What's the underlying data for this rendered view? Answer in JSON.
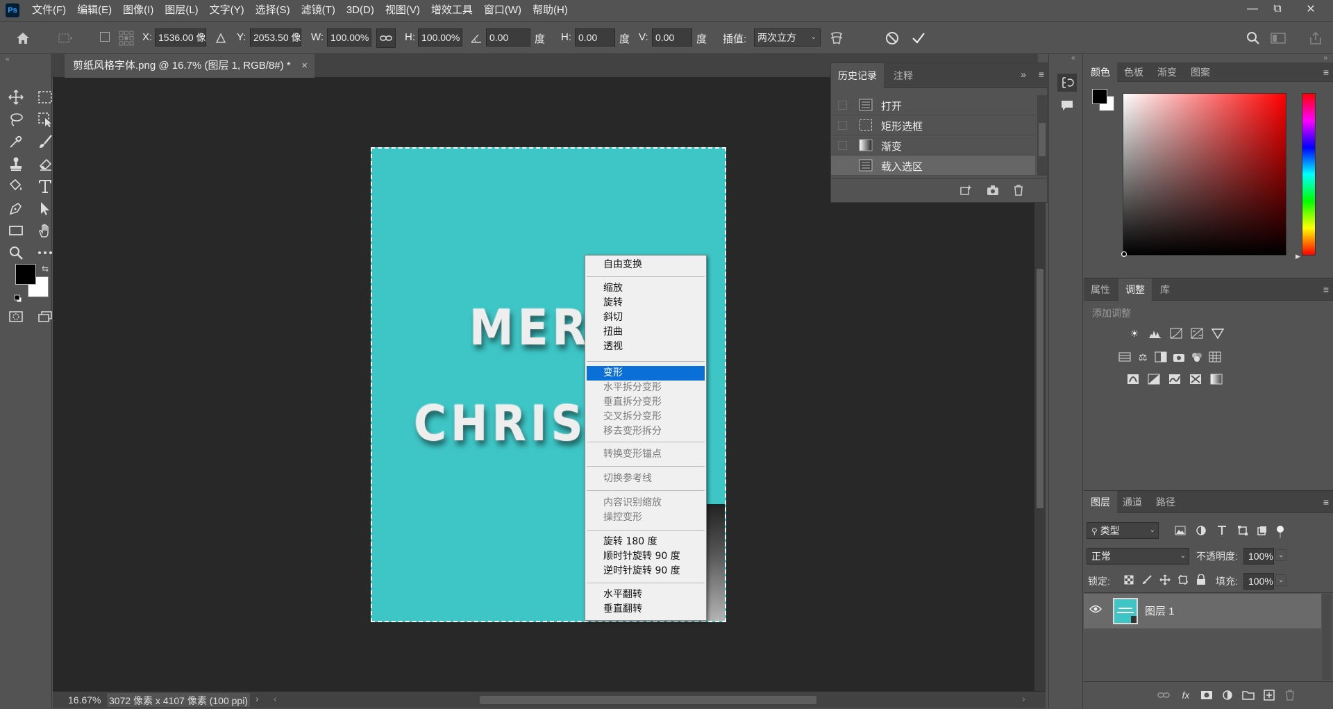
{
  "app": {
    "logo": "Ps"
  },
  "menubar": [
    "文件(F)",
    "编辑(E)",
    "图像(I)",
    "图层(L)",
    "文字(Y)",
    "选择(S)",
    "滤镜(T)",
    "3D(D)",
    "视图(V)",
    "增效工具",
    "窗口(W)",
    "帮助(H)"
  ],
  "options": {
    "x_label": "X:",
    "x_value": "1536.00 像",
    "y_label": "Y:",
    "y_value": "2053.50 像",
    "w_label": "W:",
    "w_value": "100.00%",
    "h_label": "H:",
    "h_value": "100.00%",
    "angle_value": "0.00",
    "angle_unit": "度",
    "hskew_label": "H:",
    "hskew_value": "0.00",
    "hskew_unit": "度",
    "vskew_label": "V:",
    "vskew_value": "0.00",
    "vskew_unit": "度",
    "interp_label": "插值:",
    "interp_value": "两次立方"
  },
  "document": {
    "tab_title": "剪纸风格字体.png @ 16.7% (图层 1, RGB/8#) *",
    "tab_close": "×",
    "line1": "MERR",
    "line2": "CHRIST",
    "bg_color": "#3ec6c6"
  },
  "context_menu": [
    {
      "label": "自由变换",
      "state": "normal"
    },
    {
      "label": "缩放",
      "state": "normal"
    },
    {
      "label": "旋转",
      "state": "normal"
    },
    {
      "label": "斜切",
      "state": "normal"
    },
    {
      "label": "扭曲",
      "state": "normal"
    },
    {
      "label": "透视",
      "state": "normal"
    },
    {
      "label": "变形",
      "state": "selected"
    },
    {
      "label": "水平拆分变形",
      "state": "disabled"
    },
    {
      "label": "垂直拆分变形",
      "state": "disabled"
    },
    {
      "label": "交叉拆分变形",
      "state": "disabled"
    },
    {
      "label": "移去变形拆分",
      "state": "disabled"
    },
    {
      "label": "转换变形锚点",
      "state": "disabled"
    },
    {
      "label": "切换参考线",
      "state": "disabled"
    },
    {
      "label": "内容识别缩放",
      "state": "disabled"
    },
    {
      "label": "操控变形",
      "state": "disabled"
    },
    {
      "label": "旋转 180 度",
      "state": "normal"
    },
    {
      "label": "顺时针旋转 90 度",
      "state": "normal"
    },
    {
      "label": "逆时针旋转 90 度",
      "state": "normal"
    },
    {
      "label": "水平翻转",
      "state": "normal"
    },
    {
      "label": "垂直翻转",
      "state": "normal"
    }
  ],
  "history": {
    "tabs": [
      "历史记录",
      "注释"
    ],
    "items": [
      "打开",
      "矩形选框",
      "渐变",
      "载入选区"
    ]
  },
  "color_panel": {
    "tabs": [
      "颜色",
      "色板",
      "渐变",
      "图案"
    ]
  },
  "adjust_panel": {
    "tabs": [
      "属性",
      "调整",
      "库"
    ],
    "add_label": "添加调整"
  },
  "layers_panel": {
    "tabs": [
      "图层",
      "通道",
      "路径"
    ],
    "filter_kind": "类型",
    "blend_mode": "正常",
    "opacity_label": "不透明度:",
    "opacity_value": "100%",
    "lock_label": "锁定:",
    "fill_label": "填充:",
    "fill_value": "100%",
    "layer_name": "图层 1"
  },
  "status": {
    "zoom": "16.67%",
    "size": "3072 像素 x 4107 像素 (100 ppi)"
  }
}
